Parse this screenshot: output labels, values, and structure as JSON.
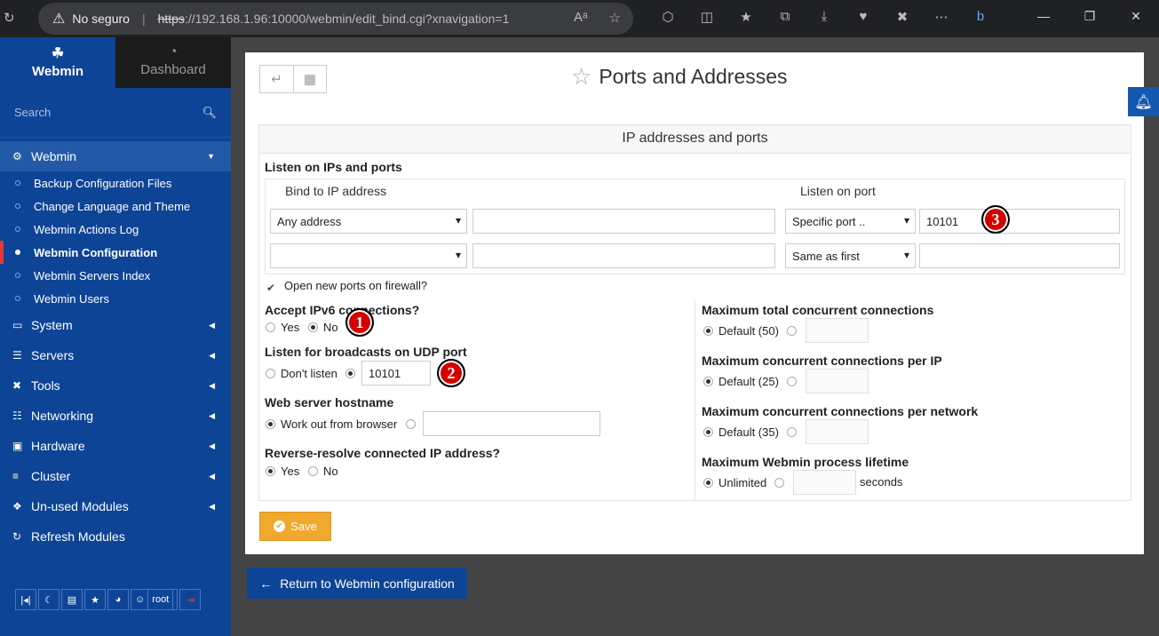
{
  "browser": {
    "security_label": "No seguro",
    "url_scheme": "https",
    "url_rest": "://192.168.1.96:10000/webmin/edit_bind.cgi?xnavigation=1"
  },
  "sidebar": {
    "tabs": [
      {
        "label": "Webmin"
      },
      {
        "label": "Dashboard"
      }
    ],
    "search_placeholder": "Search",
    "open_category": "Webmin",
    "subitems": [
      {
        "label": "Backup Configuration Files"
      },
      {
        "label": "Change Language and Theme"
      },
      {
        "label": "Webmin Actions Log"
      },
      {
        "label": "Webmin Configuration"
      },
      {
        "label": "Webmin Servers Index"
      },
      {
        "label": "Webmin Users"
      }
    ],
    "categories": [
      {
        "label": "System"
      },
      {
        "label": "Servers"
      },
      {
        "label": "Tools"
      },
      {
        "label": "Networking"
      },
      {
        "label": "Hardware"
      },
      {
        "label": "Cluster"
      },
      {
        "label": "Un-used Modules"
      },
      {
        "label": "Refresh Modules"
      }
    ],
    "user": "root"
  },
  "page": {
    "title": "Ports and Addresses",
    "section_title": "IP addresses and ports",
    "listen_label": "Listen on IPs and ports",
    "col_bind": "Bind to IP address",
    "col_port": "Listen on port",
    "rows": [
      {
        "address_select": "Any address",
        "address_value": "",
        "port_select": "Specific port ..",
        "port_value": "10101"
      },
      {
        "address_select": "",
        "address_value": "",
        "port_select": "Same as first",
        "port_value": ""
      }
    ],
    "firewall_label": "Open new ports on firewall?",
    "ipv6": {
      "label": "Accept IPv6 connections?",
      "yes": "Yes",
      "no": "No"
    },
    "udp": {
      "label": "Listen for broadcasts on UDP port",
      "dont": "Don't listen",
      "value": "10101"
    },
    "hostname": {
      "label": "Web server hostname",
      "auto": "Work out from browser",
      "value": ""
    },
    "reverse": {
      "label": "Reverse-resolve connected IP address?",
      "yes": "Yes",
      "no": "No"
    },
    "max_total": {
      "label": "Maximum total concurrent connections",
      "default": "Default (50)"
    },
    "max_ip": {
      "label": "Maximum concurrent connections per IP",
      "default": "Default (25)"
    },
    "max_net": {
      "label": "Maximum concurrent connections per network",
      "default": "Default (35)"
    },
    "lifetime": {
      "label": "Maximum Webmin process lifetime",
      "default": "Unlimited",
      "unit": "seconds"
    },
    "save_label": "Save",
    "return_label": "Return to Webmin configuration"
  },
  "badges": [
    "1",
    "2",
    "3"
  ],
  "colors": {
    "sidebar": "#0e4496",
    "save": "#f0a92e",
    "badge": "#d30000"
  }
}
